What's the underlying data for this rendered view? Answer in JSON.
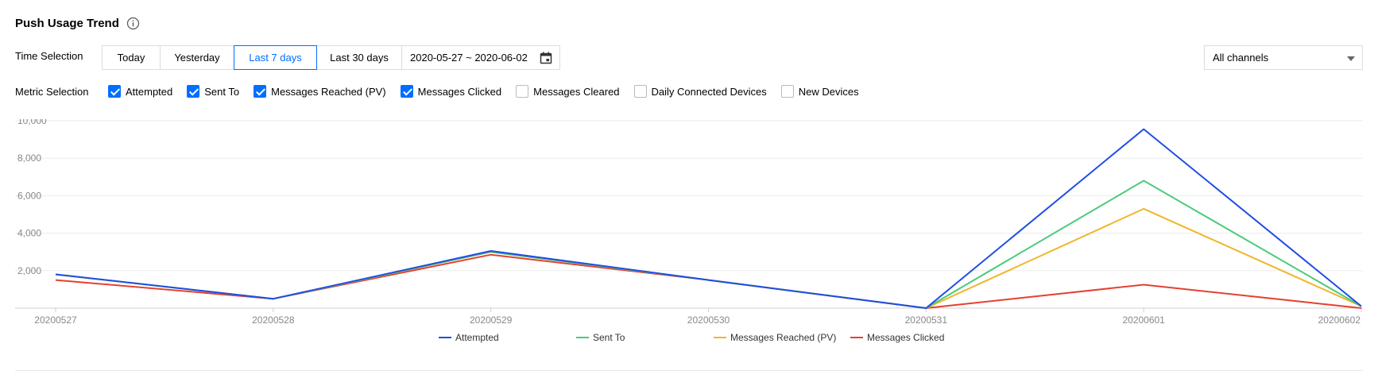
{
  "header": {
    "title": "Push Usage Trend",
    "info_icon": "info-circle-icon"
  },
  "time_selection": {
    "label": "Time Selection",
    "tabs": [
      "Today",
      "Yesterday",
      "Last 7 days",
      "Last 30 days"
    ],
    "active_tab": "Last 7 days",
    "date_range": "2020-05-27 ~ 2020-06-02",
    "calendar_icon": "calendar-icon",
    "channel_select": "All channels"
  },
  "metric_selection": {
    "label": "Metric Selection",
    "options": [
      {
        "label": "Attempted",
        "checked": true
      },
      {
        "label": "Sent To",
        "checked": true
      },
      {
        "label": "Messages Reached (PV)",
        "checked": true
      },
      {
        "label": "Messages Clicked",
        "checked": true
      },
      {
        "label": "Messages Cleared",
        "checked": false
      },
      {
        "label": "Daily Connected Devices",
        "checked": false
      },
      {
        "label": "New Devices",
        "checked": false
      }
    ]
  },
  "colors": {
    "accent": "#006eff"
  },
  "chart_data": {
    "type": "line",
    "x": [
      "20200527",
      "20200528",
      "20200529",
      "20200530",
      "20200531",
      "20200601",
      "20200602"
    ],
    "ylim": [
      0,
      10000
    ],
    "yticks": [
      "10,000",
      "8,000",
      "6,000",
      "4,000",
      "2,000"
    ],
    "ytick_values": [
      10000,
      8000,
      6000,
      4000,
      2000
    ],
    "grid": true,
    "legend": "bottom",
    "series": [
      {
        "name": "Attempted",
        "color": "#1f4de4",
        "values": [
          1800,
          500,
          3050,
          1500,
          0,
          9550,
          100
        ]
      },
      {
        "name": "Sent To",
        "color": "#4bcb7a",
        "values": [
          1800,
          500,
          3000,
          1500,
          0,
          6800,
          100
        ]
      },
      {
        "name": "Messages Reached (PV)",
        "color": "#f0b62c",
        "values": [
          1800,
          500,
          3000,
          1500,
          0,
          5300,
          100
        ]
      },
      {
        "name": "Messages Clicked",
        "color": "#e5412f",
        "values": [
          1500,
          500,
          2850,
          1500,
          0,
          1250,
          0
        ]
      }
    ]
  }
}
